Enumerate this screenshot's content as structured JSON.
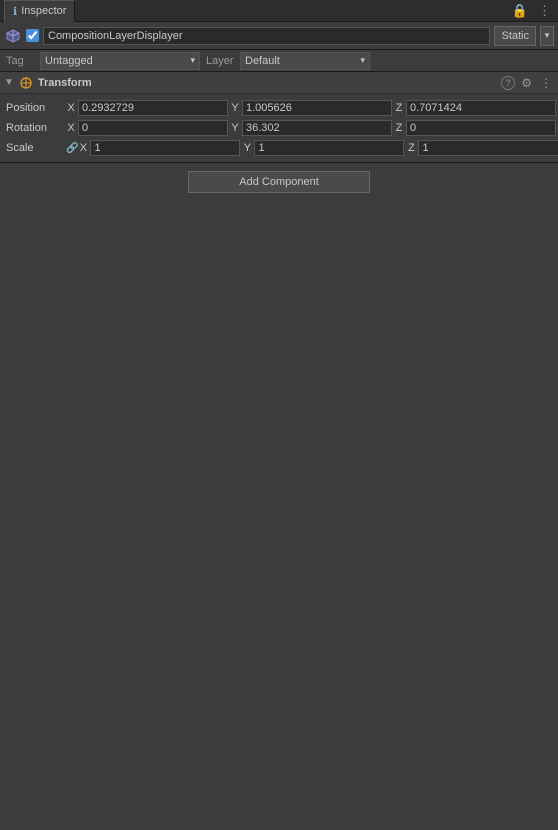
{
  "header": {
    "tab_label": "Inspector",
    "lock_icon": "🔒",
    "menu_icon": "⋮"
  },
  "object": {
    "checkbox_checked": true,
    "name": "CompositionLayerDisplayer",
    "static_label": "Static",
    "static_dropdown_arrow": "▾"
  },
  "tag_layer": {
    "tag_label": "Tag",
    "tag_value": "Untagged",
    "tag_arrow": "▾",
    "layer_label": "Layer",
    "layer_value": "Default",
    "layer_arrow": "▾"
  },
  "transform": {
    "section_title": "Transform",
    "collapse_arrow": "▼",
    "help_icon": "?",
    "settings_icon": "⚙",
    "menu_icon": "⋮",
    "position_label": "Position",
    "rotation_label": "Rotation",
    "scale_label": "Scale",
    "position": {
      "x_label": "X",
      "x_value": "0.2932729",
      "y_label": "Y",
      "y_value": "1.005626",
      "z_label": "Z",
      "z_value": "0.7071424"
    },
    "rotation": {
      "x_label": "X",
      "x_value": "0",
      "y_label": "Y",
      "y_value": "36.302",
      "z_label": "Z",
      "z_value": "0"
    },
    "scale": {
      "x_label": "X",
      "x_value": "1",
      "y_label": "Y",
      "y_value": "1",
      "z_label": "Z",
      "z_value": "1"
    }
  },
  "add_component": {
    "button_label": "Add Component"
  }
}
